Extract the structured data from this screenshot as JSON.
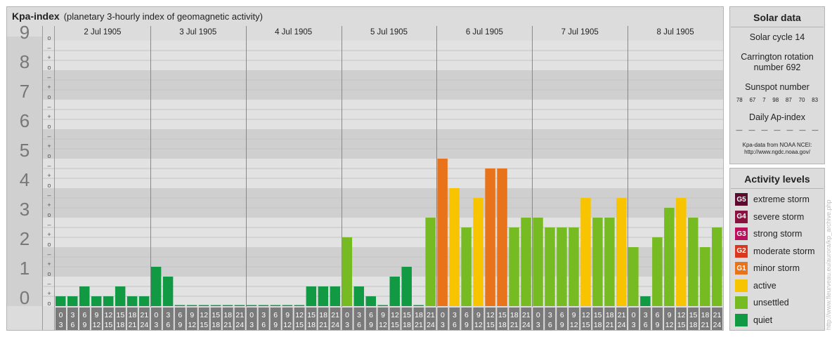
{
  "header": {
    "title": "Kpa-index",
    "subtitle": "(planetary 3-hourly index of geomagnetic activity)"
  },
  "chart_data": {
    "type": "bar",
    "title": "Kpa-index",
    "subtitle": "(planetary 3-hourly index of geomagnetic activity)",
    "ylim": [
      0,
      9
    ],
    "y_ticks": [
      "0",
      "1",
      "2",
      "3",
      "4",
      "5",
      "6",
      "7",
      "8",
      "9"
    ],
    "minor_tick_labels": [
      "o",
      "+",
      "–",
      "o",
      "+",
      "–",
      "o",
      "+",
      "–",
      "o",
      "+",
      "–",
      "o",
      "+",
      "–",
      "o",
      "+",
      "–",
      "o",
      "+",
      "–",
      "o",
      "+",
      "–",
      "o",
      "+",
      "–",
      "o"
    ],
    "days": [
      "2 Jul 1905",
      "3 Jul 1905",
      "4 Jul 1905",
      "5 Jul 1905",
      "6 Jul 1905",
      "7 Jul 1905",
      "8 Jul 1905"
    ],
    "interval_start_labels": [
      "0",
      "3",
      "6",
      "9",
      "12",
      "15",
      "18",
      "21"
    ],
    "interval_end_labels": [
      "3",
      "6",
      "9",
      "12",
      "15",
      "18",
      "21",
      "24"
    ],
    "values": [
      [
        0.333,
        0.333,
        0.667,
        0.333,
        0.333,
        0.667,
        0.333,
        0.333
      ],
      [
        1.333,
        1.0,
        0,
        0,
        0,
        0,
        0,
        0
      ],
      [
        0,
        0,
        0,
        0,
        0,
        0.667,
        0.667,
        0.667
      ],
      [
        2.333,
        0.667,
        0.333,
        0,
        1.0,
        1.333,
        0,
        3.0
      ],
      [
        5.0,
        4.0,
        2.667,
        3.667,
        4.667,
        4.667,
        2.667,
        3.0
      ],
      [
        3.0,
        2.667,
        2.667,
        2.667,
        3.667,
        3.0,
        3.0,
        3.667
      ],
      [
        2.0,
        0.333,
        2.333,
        3.333,
        3.667,
        3.0,
        2.0,
        2.667
      ]
    ],
    "levels": [
      [
        7,
        7,
        7,
        7,
        7,
        7,
        7,
        7
      ],
      [
        7,
        7,
        7,
        7,
        7,
        7,
        7,
        7
      ],
      [
        7,
        7,
        7,
        7,
        7,
        7,
        7,
        7
      ],
      [
        6,
        7,
        7,
        7,
        7,
        7,
        7,
        6
      ],
      [
        4,
        5,
        6,
        5,
        4,
        4,
        6,
        6
      ],
      [
        6,
        6,
        6,
        6,
        5,
        6,
        6,
        5
      ],
      [
        6,
        7,
        6,
        6,
        5,
        6,
        6,
        6
      ]
    ],
    "grid": true
  },
  "solar": {
    "heading": "Solar data",
    "cycle": "Solar cycle 14",
    "carrington_line1": "Carrington rotation",
    "carrington_line2": "number 692",
    "sunspot_label": "Sunspot number",
    "sunspots": [
      "78",
      "67",
      "7",
      "98",
      "87",
      "70",
      "83"
    ],
    "ap_label": "Daily Ap-index",
    "ap_values": [
      "––",
      "––",
      "––",
      "––",
      "––",
      "––",
      "––"
    ],
    "source_line1": "Kpa-data from NOAA NCEI:",
    "source_line2": "http://www.ngdc.noaa.gov/"
  },
  "activity": {
    "heading": "Activity levels",
    "items": [
      {
        "code": "G5",
        "label": "extreme storm",
        "color": "#5c0a2e"
      },
      {
        "code": "G4",
        "label": "severe storm",
        "color": "#8a1040"
      },
      {
        "code": "G3",
        "label": "strong storm",
        "color": "#b8105a"
      },
      {
        "code": "G2",
        "label": "moderate storm",
        "color": "#d9381e"
      },
      {
        "code": "G1",
        "label": "minor storm",
        "color": "#e8731a"
      },
      {
        "code": "",
        "label": "active",
        "color": "#f8c400"
      },
      {
        "code": "",
        "label": "unsettled",
        "color": "#77bb22"
      },
      {
        "code": "",
        "label": "quiet",
        "color": "#119944"
      }
    ]
  },
  "watermark": "http://www.fleurveau.eu/aurora/kp_archive.php"
}
